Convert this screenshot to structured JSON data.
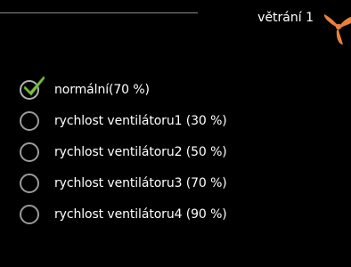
{
  "header": {
    "title": "větrání 1",
    "icon": "fan-icon",
    "icon_color": "#e8823a"
  },
  "options": [
    {
      "label": "normální(70 %)",
      "selected": true
    },
    {
      "label": "rychlost ventilátoru1 (30 %)",
      "selected": false
    },
    {
      "label": "rychlost ventilátoru2 (50 %)",
      "selected": false
    },
    {
      "label": "rychlost ventilátoru3 (70 %)",
      "selected": false
    },
    {
      "label": "rychlost ventilátoru4 (90 %)",
      "selected": false
    }
  ],
  "colors": {
    "background": "#000000",
    "text": "#ffffff",
    "radio_border": "#9a9a9a",
    "check": "#7ec242"
  }
}
